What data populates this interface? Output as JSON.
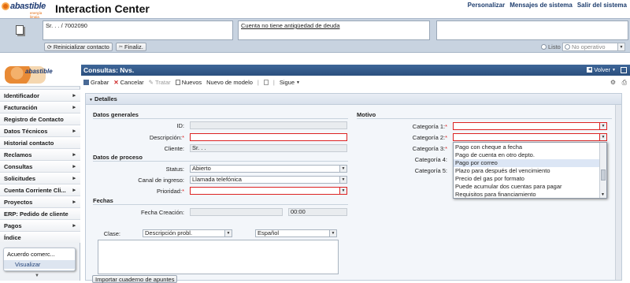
{
  "header": {
    "logo_text": "abastible",
    "logo_sub": "energía limpia",
    "title": "Interaction Center",
    "links": [
      "Personalizar",
      "Mensajes de sistema",
      "Salir del sistema"
    ]
  },
  "contact_bar": {
    "caller": "Sr. . . / 7002090",
    "message": "Cuenta no tiene antigüedad de deuda",
    "reset_label": "Reinicializar contacto",
    "finalize_label": "Finaliz.",
    "status_ready": "Listo",
    "status_select": "No operativo"
  },
  "sidebar": {
    "logo_text": "abastible",
    "items": [
      {
        "label": "Identificador",
        "arrow": true
      },
      {
        "label": "Facturación",
        "arrow": true
      },
      {
        "label": "Registro de Contacto",
        "arrow": false
      },
      {
        "label": "Datos Técnicos",
        "arrow": true
      },
      {
        "label": "Historial contacto",
        "arrow": false
      },
      {
        "label": "Reclamos",
        "arrow": true
      },
      {
        "label": "Consultas",
        "arrow": true
      },
      {
        "label": "Solicitudes",
        "arrow": true
      },
      {
        "label": "Cuenta Corriente Cli...",
        "arrow": true
      },
      {
        "label": "Proyectos",
        "arrow": true
      },
      {
        "label": "ERP: Pedido de cliente",
        "arrow": false
      },
      {
        "label": "Pagos",
        "arrow": true
      },
      {
        "label": "Índice",
        "arrow": false
      }
    ],
    "agreement_title": "Acuerdo comerc...",
    "agreement_action": "Visualizar"
  },
  "main": {
    "title": "Consultas: Nvs.",
    "back_label": "Volver",
    "toolbar": {
      "save": "Grabar",
      "cancel": "Cancelar",
      "process": "Tratar",
      "new": "Nuevos",
      "new_model": "Nuevo de modelo",
      "next": "Sigue"
    },
    "details_label": "Detalles",
    "general": {
      "heading": "Datos generales",
      "id_label": "ID:",
      "id_value": "",
      "desc_label": "Descripción:",
      "desc_value": "",
      "client_label": "Cliente:",
      "client_value": "Sr. . ."
    },
    "process": {
      "heading": "Datos de proceso",
      "status_label": "Status:",
      "status_value": "Abierto",
      "channel_label": "Canal de ingreso:",
      "channel_value": "Llamada telefónica",
      "priority_label": "Prioridad:",
      "priority_value": ""
    },
    "dates": {
      "heading": "Fechas",
      "created_label": "Fecha Creación:",
      "created_date": "",
      "created_time": "00:00"
    },
    "notes": {
      "class_label": "Clase:",
      "class_value": "Descripción probl.",
      "language_value": "Español",
      "import_label": "Importar cuaderno de apuntes"
    },
    "motive": {
      "heading": "Motivo",
      "cat1_label": "Categoría 1:",
      "cat2_label": "Categoría 2:",
      "cat3_label": "Categoría 3:",
      "cat4_label": "Categoría 4:",
      "cat5_label": "Categoría 5:",
      "dropdown_options": [
        "Pago con cheque a fecha",
        "Pago de cuenta en otro depto.",
        "Pago por correo",
        "Plazo para después del vencimiento",
        "Precio del gas por formato",
        "Puede acumular dos cuentas para pagar",
        "Requisitos para financiamiento"
      ],
      "highlighted_index": 2
    }
  },
  "colors": {
    "accent_blue": "#2b4f7e",
    "required": "#dd2222",
    "popup_highlight": "#dce6f5"
  }
}
